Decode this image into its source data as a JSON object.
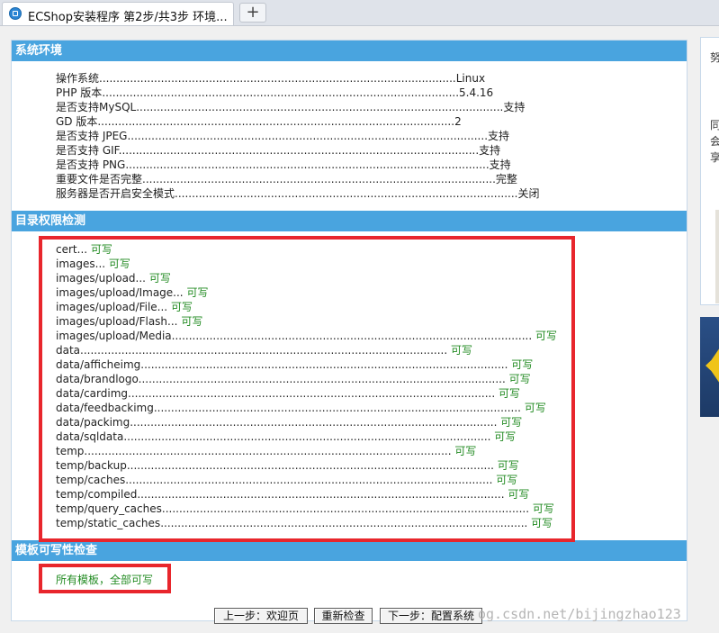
{
  "tab": {
    "title": "ECShop安装程序 第2步/共3步 环境...",
    "new_tab_label": "+"
  },
  "system_env": {
    "title": "系统环境",
    "rows": [
      {
        "label": "操作系统",
        "dots": "........................................................................................................",
        "value": "Linux"
      },
      {
        "label": "PHP 版本",
        "dots": "........................................................................................................",
        "value": "5.4.16"
      },
      {
        "label": "是否支持MySQL",
        "dots": "...........................................................................................................",
        "value": "支持"
      },
      {
        "label": "GD 版本",
        "dots": "........................................................................................................",
        "value": "2"
      },
      {
        "label": "是否支持 JPEG",
        "dots": ".........................................................................................................",
        "value": "支持"
      },
      {
        "label": "是否支持 GIF",
        "dots": ".........................................................................................................",
        "value": "支持"
      },
      {
        "label": "是否支持 PNG",
        "dots": "..........................................................................................................",
        "value": "支持"
      },
      {
        "label": "重要文件是否完整",
        "dots": ".......................................................................................................",
        "value": "完整"
      },
      {
        "label": "服务器是否开启安全模式",
        "dots": "....................................................................................................",
        "value": "关闭"
      }
    ]
  },
  "dir_perm": {
    "title": "目录权限检测",
    "rows": [
      {
        "label": "cert",
        "dots": "........................................................................................................",
        "value": "可写"
      },
      {
        "label": "images",
        "dots": "..........................................................................................................",
        "value": "可写"
      },
      {
        "label": "images/upload",
        "dots": "...........................................................................................................",
        "value": "可写"
      },
      {
        "label": "images/upload/Image",
        "dots": "...........................................................................................................",
        "value": "可写"
      },
      {
        "label": "images/upload/File",
        "dots": "...........................................................................................................",
        "value": "可写"
      },
      {
        "label": "images/upload/Flash",
        "dots": "...........................................................................................................",
        "value": "可写"
      },
      {
        "label": "images/upload/Media",
        "dots": "...........................................................................................................",
        "value": "可写"
      },
      {
        "label": "data",
        "dots": "...........................................................................................................",
        "value": "可写"
      },
      {
        "label": "data/afficheimg",
        "dots": "...........................................................................................................",
        "value": "可写"
      },
      {
        "label": "data/brandlogo",
        "dots": "...........................................................................................................",
        "value": "可写"
      },
      {
        "label": "data/cardimg",
        "dots": "...........................................................................................................",
        "value": "可写"
      },
      {
        "label": "data/feedbackimg",
        "dots": "...........................................................................................................",
        "value": "可写"
      },
      {
        "label": "data/packimg",
        "dots": "...........................................................................................................",
        "value": "可写"
      },
      {
        "label": "data/sqldata",
        "dots": "...........................................................................................................",
        "value": "可写"
      },
      {
        "label": "temp",
        "dots": "...........................................................................................................",
        "value": "可写"
      },
      {
        "label": "temp/backup",
        "dots": "...........................................................................................................",
        "value": "可写"
      },
      {
        "label": "temp/caches",
        "dots": "...........................................................................................................",
        "value": "可写"
      },
      {
        "label": "temp/compiled",
        "dots": "...........................................................................................................",
        "value": "可写"
      },
      {
        "label": "temp/query_caches",
        "dots": "...........................................................................................................",
        "value": "可写"
      },
      {
        "label": "temp/static_caches",
        "dots": "...........................................................................................................",
        "value": "可写"
      }
    ]
  },
  "template_check": {
    "title": "模板可写性检查",
    "result": "所有模板，全部可写"
  },
  "buttons": {
    "prev": "上一步：欢迎页",
    "recheck": "重新检查",
    "next": "下一步：配置系统"
  },
  "watermark": "og.csdn.net/bijingzhao123",
  "sidebar": {
    "char1": "努",
    "char2": "同",
    "char3": "会",
    "char4": "享"
  },
  "colors": {
    "header_blue": "#49a4df",
    "highlight_red": "#e8262c",
    "ok_green": "#228b22"
  }
}
